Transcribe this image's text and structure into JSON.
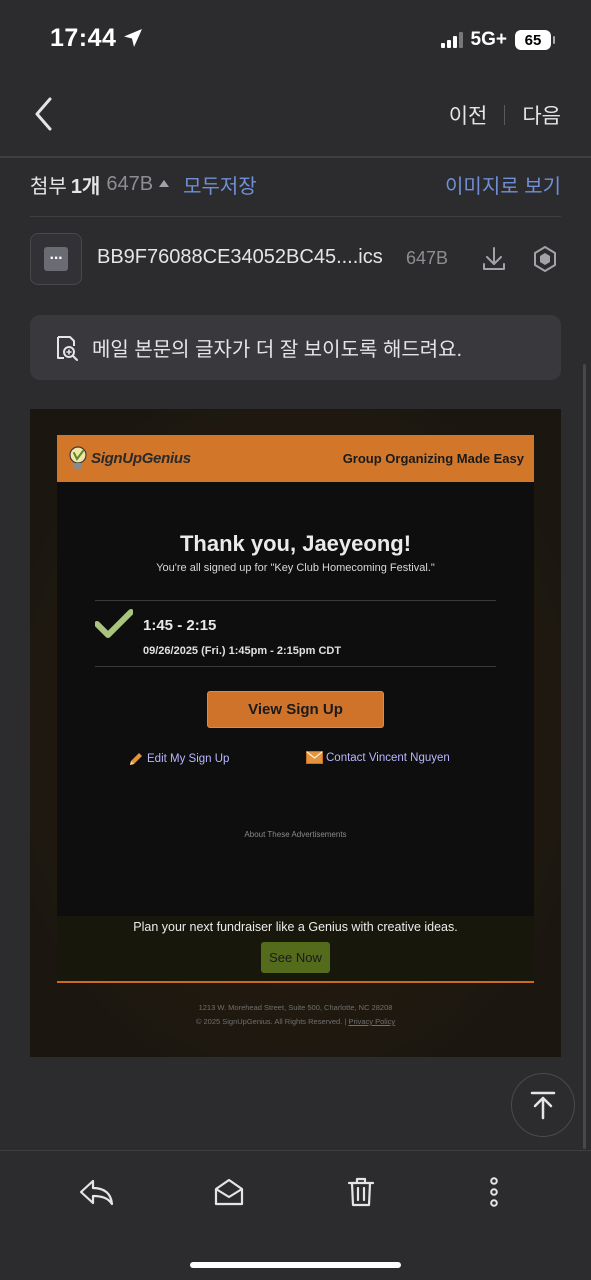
{
  "status_bar": {
    "time": "17:44",
    "network": "5G+",
    "battery": "65"
  },
  "nav": {
    "prev_label": "이전",
    "next_label": "다음"
  },
  "attachments": {
    "label": "첨부",
    "count": "1개",
    "total_size": "647B",
    "save_all": "모두저장",
    "view_images": "이미지로 보기",
    "file": {
      "name": "BB9F76088CE34052BC45....ics",
      "size": "647B"
    }
  },
  "readability_banner": {
    "text": "메일 본문의 글자가 더 잘 보이도록 해드려요."
  },
  "email": {
    "brand": "SignUpGenius",
    "tagline": "Group Organizing Made Easy",
    "title": "Thank you, Jaeyeong!",
    "subtitle": "You're all signed up for \"Key Club Homecoming Festival.\"",
    "slot": {
      "time": "1:45 - 2:15",
      "date": "09/26/2025 (Fri.) 1:45pm - 2:15pm CDT"
    },
    "view_button": "View Sign Up",
    "edit_link": "Edit My Sign Up",
    "contact_link": "Contact Vincent Nguyen",
    "about_ads": "About These Advertisements",
    "promo_text": "Plan your next fundraiser like a Genius with creative ideas.",
    "see_now_button": "See Now",
    "footer_address": "1213 W. Morehead Street, Suite 500, Charlotte, NC 28208",
    "footer_copyright": "© 2025 SignUpGenius. All Rights Reserved. |",
    "privacy_link": "Privacy Policy"
  },
  "colors": {
    "accent_link": "#6f8fd6",
    "brand_orange": "#d2772a",
    "check_green": "#a9c47f",
    "promo_green": "#556b1c"
  },
  "toolbar": {
    "icons": [
      "reply-icon",
      "mark-unread-icon",
      "trash-icon",
      "more-icon"
    ]
  }
}
